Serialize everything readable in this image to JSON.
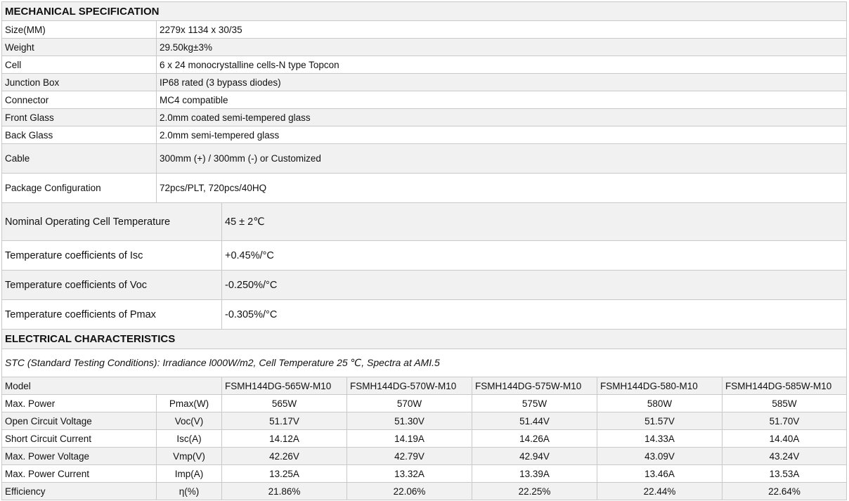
{
  "mechanical": {
    "title": "MECHANICAL SPECIFICATION",
    "rows": [
      {
        "label": "Size(MM)",
        "value": "2279x 1134 x 30/35"
      },
      {
        "label": "Weight",
        "value": "29.50kg±3%"
      },
      {
        "label": "Cell",
        "value": "6 x 24 monocrystalline cells-N type Topcon"
      },
      {
        "label": "Junction Box",
        "value": "IP68 rated (3 bypass diodes)"
      },
      {
        "label": "Connector",
        "value": "MC4 compatible"
      },
      {
        "label": "Front Glass",
        "value": "2.0mm coated semi-tempered glass"
      },
      {
        "label": "Back Glass",
        "value": "2.0mm semi-tempered glass"
      },
      {
        "label": "Cable",
        "value": "300mm (+) / 300mm (-) or Customized"
      },
      {
        "label": "Package Configuration",
        "value": "72pcs/PLT, 720pcs/40HQ"
      }
    ]
  },
  "temperature": {
    "rows": [
      {
        "label": "Nominal Operating Cell Temperature",
        "value": "45 ± 2℃"
      },
      {
        "label": "Temperature coefficients of Isc",
        "value": "+0.45%/°C"
      },
      {
        "label": "Temperature coefficients of Voc",
        "value": "-0.250%/°C"
      },
      {
        "label": "Temperature coefficients of Pmax",
        "value": "-0.305%/°C"
      }
    ]
  },
  "electrical": {
    "title": "ELECTRICAL CHARACTERISTICS",
    "stc": "STC (Standard Testing Conditions): Irradiance l000W/m2, Cell Temperature 25 ℃, Spectra at AMI.5",
    "model_label": "Model",
    "models": [
      "FSMH144DG-565W-M10",
      "FSMH144DG-570W-M10",
      "FSMH144DG-575W-M10",
      "FSMH144DG-580-M10",
      "FSMH144DG-585W-M10"
    ],
    "rows": [
      {
        "label": "Max. Power",
        "unit": "Pmax(W)",
        "values": [
          "565W",
          "570W",
          "575W",
          "580W",
          "585W"
        ]
      },
      {
        "label": "Open Circuit Voltage",
        "unit": "Voc(V)",
        "values": [
          "51.17V",
          "51.30V",
          "51.44V",
          "51.57V",
          "51.70V"
        ]
      },
      {
        "label": "Short Circuit Current",
        "unit": "Isc(A)",
        "values": [
          "14.12A",
          "14.19A",
          "14.26A",
          "14.33A",
          "14.40A"
        ]
      },
      {
        "label": "Max. Power Voltage",
        "unit": "Vmp(V)",
        "values": [
          "42.26V",
          "42.79V",
          "42.94V",
          "43.09V",
          "43.24V"
        ]
      },
      {
        "label": "Max. Power Current",
        "unit": "Imp(A)",
        "values": [
          "13.25A",
          "13.32A",
          "13.39A",
          "13.46A",
          "13.53A"
        ]
      },
      {
        "label": "Efficiency",
        "unit": "η(%)",
        "values": [
          "21.86%",
          "22.06%",
          "22.25%",
          "22.44%",
          "22.64%"
        ]
      }
    ]
  }
}
